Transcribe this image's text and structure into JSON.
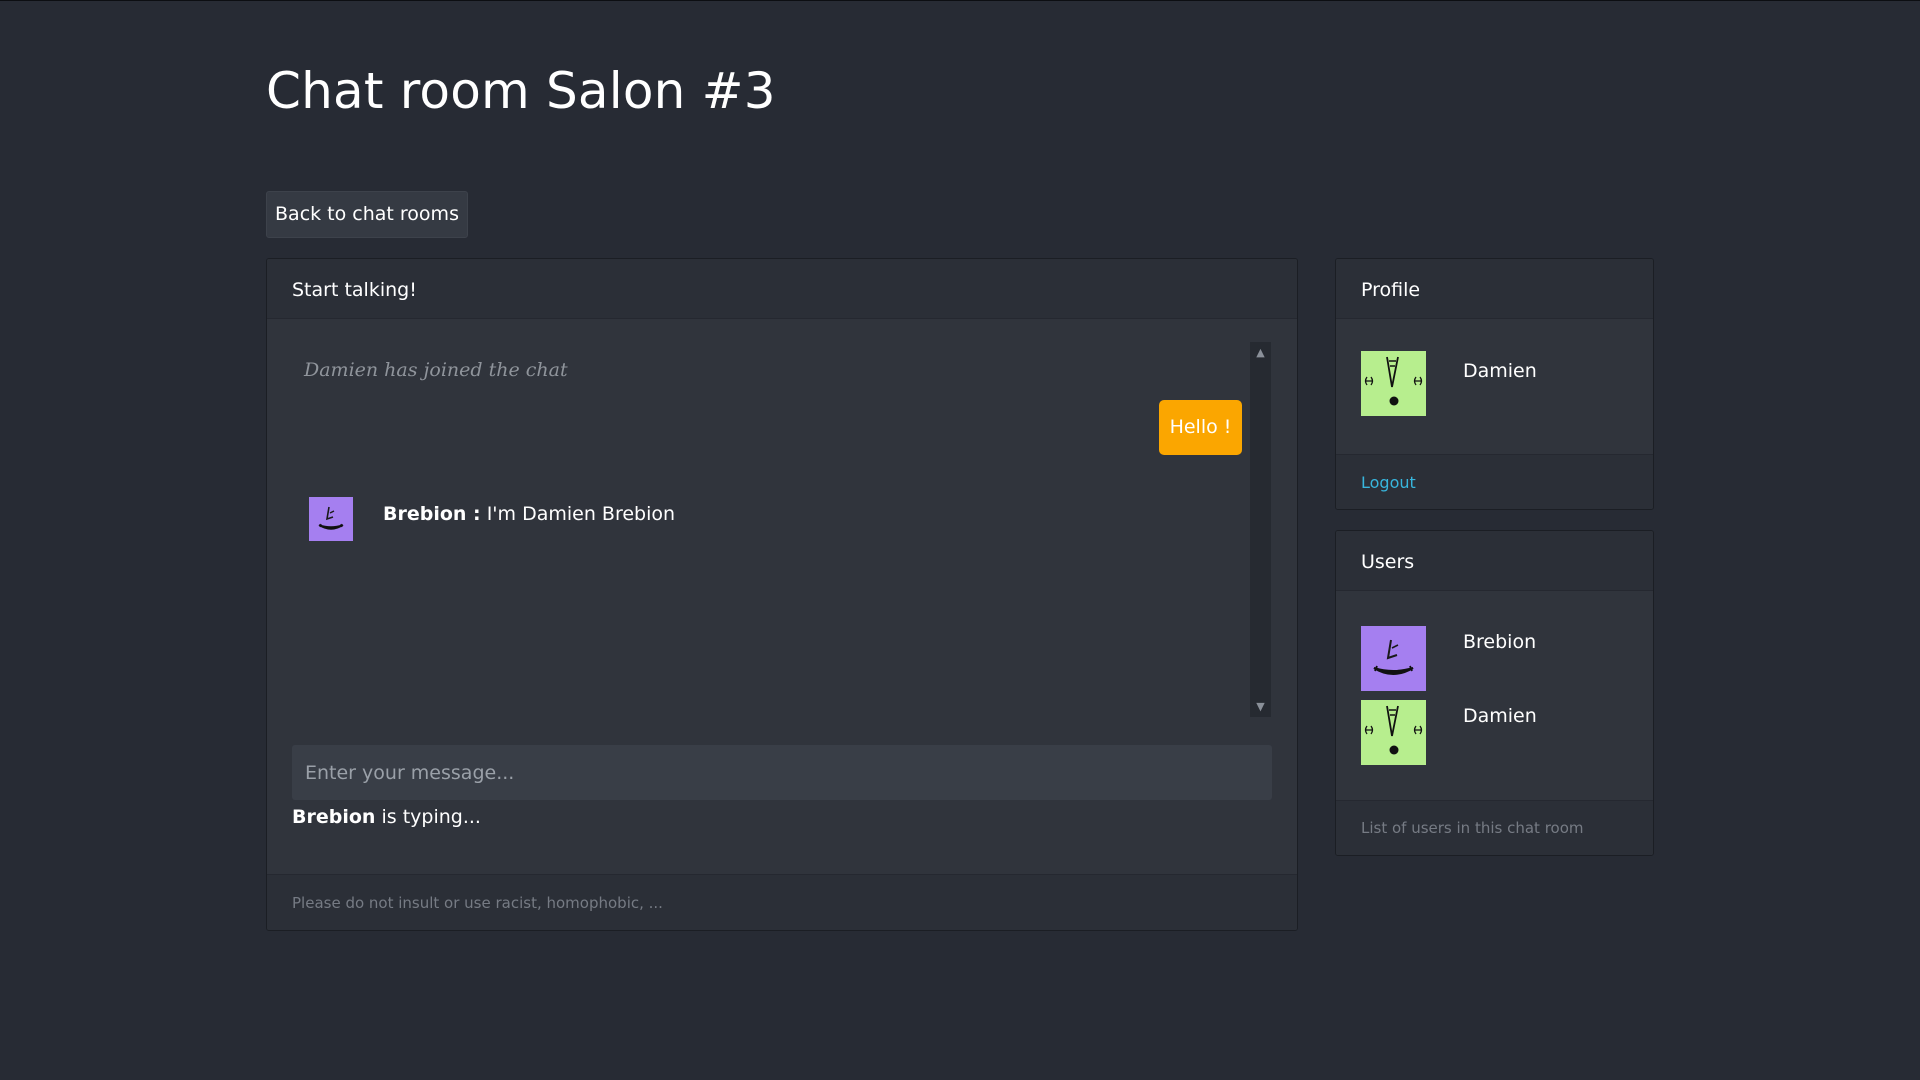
{
  "page": {
    "title": "Chat room Salon #3",
    "back_button_label": "Back to chat rooms"
  },
  "chat": {
    "header": "Start talking!",
    "messages": [
      {
        "type": "system",
        "text": "Damien has joined the chat"
      },
      {
        "type": "own",
        "text": "Hello !"
      },
      {
        "type": "other",
        "author": "Brebion :",
        "text": "I'm Damien Brebion",
        "avatar": "purple-face-avatar"
      }
    ],
    "input": {
      "value": "",
      "placeholder": "Enter your message..."
    },
    "typing": {
      "user": "Brebion",
      "text": "is typing..."
    },
    "footer": "Please do not insult or use racist, homophobic, ..."
  },
  "profile": {
    "header": "Profile",
    "name": "Damien",
    "avatar": "green-face-avatar",
    "logout_label": "Logout"
  },
  "users": {
    "header": "Users",
    "items": [
      {
        "name": "Brebion",
        "avatar": "purple-face-avatar"
      },
      {
        "name": "Damien",
        "avatar": "green-face-avatar"
      }
    ],
    "footer": "List of users in this chat room"
  },
  "icons": {
    "scroll_up": "chevron-up-icon",
    "scroll_down": "chevron-down-icon"
  },
  "colors": {
    "background": "#272b34",
    "card": "#30343c",
    "card_header": "#2b2f37",
    "own_bubble": "#fba600",
    "link": "#38b6dd",
    "avatar_purple": "#a57ff0",
    "avatar_green": "#b7ee8e"
  }
}
